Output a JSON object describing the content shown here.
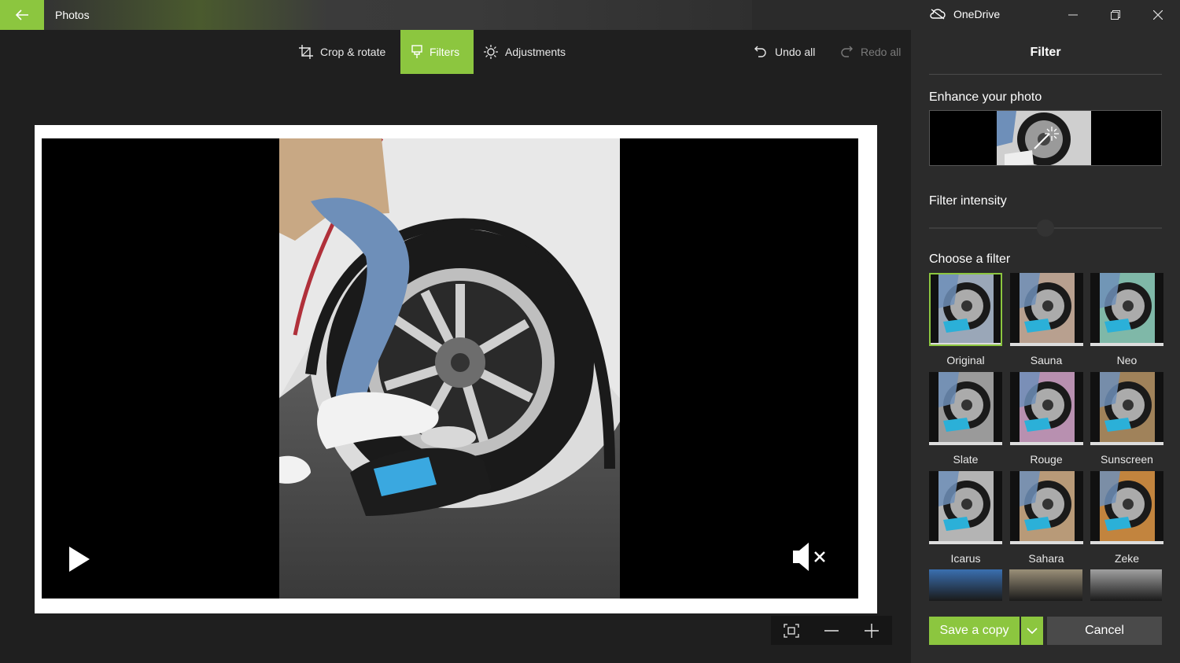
{
  "titlebar": {
    "app_title": "Photos",
    "onedrive_label": "OneDrive",
    "accent": "#8cc63f"
  },
  "toolbar": {
    "crop_label": "Crop & rotate",
    "filters_label": "Filters",
    "adjustments_label": "Adjustments",
    "undo_label": "Undo all",
    "redo_label": "Redo all"
  },
  "panel": {
    "title": "Filter",
    "enhance_label": "Enhance your photo",
    "intensity_label": "Filter intensity",
    "choose_label": "Choose a filter",
    "filters": [
      {
        "label": "Original",
        "selected": true
      },
      {
        "label": "Sauna"
      },
      {
        "label": "Neo"
      },
      {
        "label": "Slate"
      },
      {
        "label": "Rouge"
      },
      {
        "label": "Sunscreen"
      },
      {
        "label": "Icarus"
      },
      {
        "label": "Sahara"
      },
      {
        "label": "Zeke"
      }
    ],
    "save_label": "Save a copy",
    "cancel_label": "Cancel"
  }
}
